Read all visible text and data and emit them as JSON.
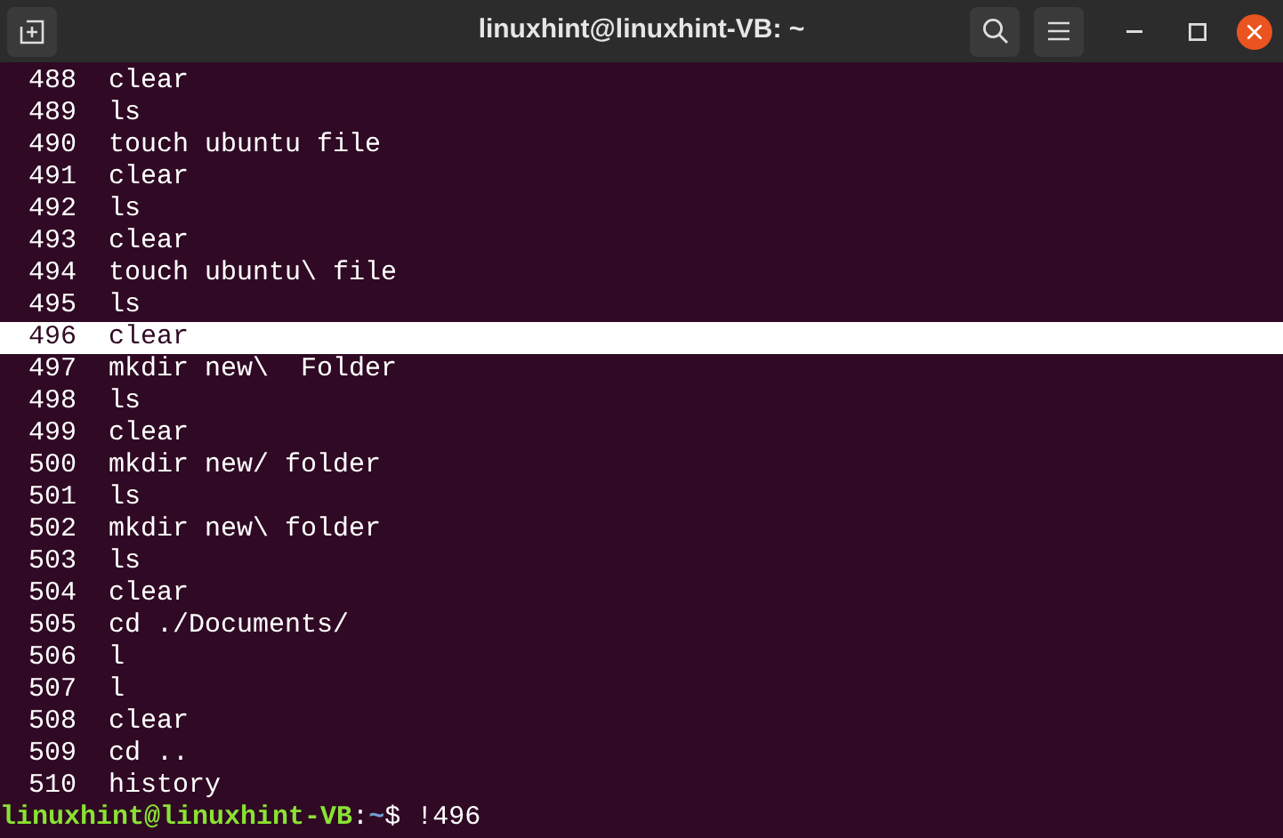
{
  "window": {
    "title": "linuxhint@linuxhint-VB: ~"
  },
  "history": [
    {
      "number": "488",
      "command": "clear",
      "selected": false
    },
    {
      "number": "489",
      "command": "ls",
      "selected": false
    },
    {
      "number": "490",
      "command": "touch ubuntu file",
      "selected": false
    },
    {
      "number": "491",
      "command": "clear",
      "selected": false
    },
    {
      "number": "492",
      "command": "ls",
      "selected": false
    },
    {
      "number": "493",
      "command": "clear",
      "selected": false
    },
    {
      "number": "494",
      "command": "touch ubuntu\\ file",
      "selected": false
    },
    {
      "number": "495",
      "command": "ls",
      "selected": false
    },
    {
      "number": "496",
      "command": "clear",
      "selected": true
    },
    {
      "number": "497",
      "command": "mkdir new\\  Folder",
      "selected": false
    },
    {
      "number": "498",
      "command": "ls",
      "selected": false
    },
    {
      "number": "499",
      "command": "clear",
      "selected": false
    },
    {
      "number": "500",
      "command": "mkdir new/ folder",
      "selected": false
    },
    {
      "number": "501",
      "command": "ls",
      "selected": false
    },
    {
      "number": "502",
      "command": "mkdir new\\ folder",
      "selected": false
    },
    {
      "number": "503",
      "command": "ls",
      "selected": false
    },
    {
      "number": "504",
      "command": "clear",
      "selected": false
    },
    {
      "number": "505",
      "command": "cd ./Documents/",
      "selected": false
    },
    {
      "number": "506",
      "command": "l",
      "selected": false
    },
    {
      "number": "507",
      "command": "l",
      "selected": false
    },
    {
      "number": "508",
      "command": "clear",
      "selected": false
    },
    {
      "number": "509",
      "command": "cd ..",
      "selected": false
    },
    {
      "number": "510",
      "command": "history",
      "selected": false
    }
  ],
  "prompt": {
    "user_host": "linuxhint@linuxhint-VB",
    "separator": ":",
    "path": "~",
    "symbol": "$",
    "command": "!496"
  }
}
